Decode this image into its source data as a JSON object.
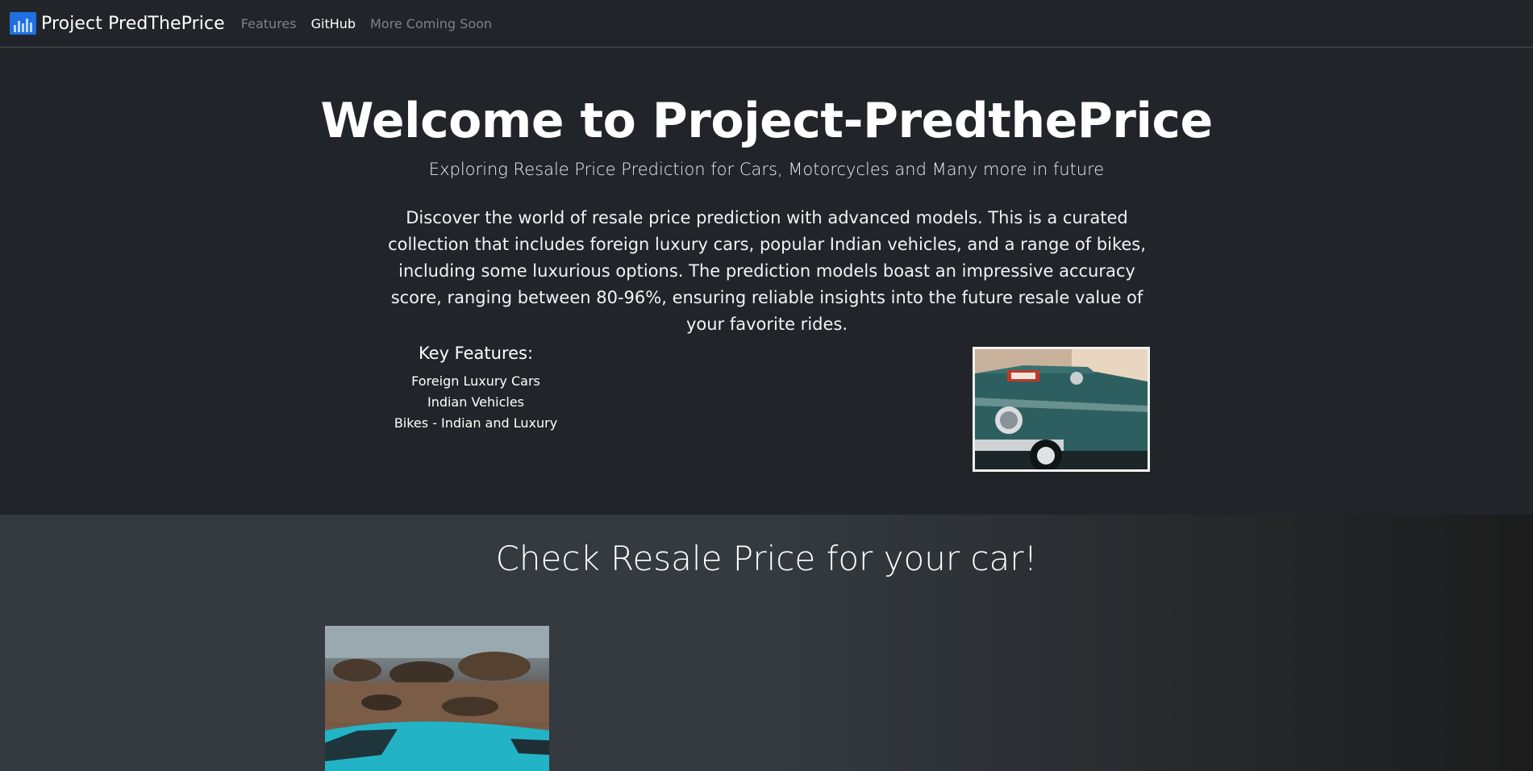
{
  "nav": {
    "brand": "Project PredThePrice",
    "links": [
      "Features",
      "GitHub",
      "More Coming Soon"
    ]
  },
  "hero": {
    "title": "Welcome to Project-PredthePrice",
    "subtitle": "Exploring Resale Price Prediction for Cars, Motorcycles and Many more in future",
    "description": "Discover the world of resale price prediction with advanced models. This is a curated collection that includes foreign luxury cars, popular Indian vehicles, and a range of bikes, including some luxurious options. The prediction models boast an impressive accuracy score, ranging between 80-96%, ensuring reliable insights into the future resale value of your favorite rides.",
    "features_heading": "Key Features:",
    "features": [
      "Foreign Luxury Cars",
      "Indian Vehicles",
      "Bikes - Indian and Luxury"
    ]
  },
  "resale": {
    "title": "Check Resale Price for your car!"
  },
  "colors": {
    "background": "#212529",
    "section_bg": "#343a40",
    "brand_blue": "#1e6fe0",
    "muted_link": "#7d8287"
  },
  "icons": {
    "brand_logo": "bar-chart-icon"
  }
}
